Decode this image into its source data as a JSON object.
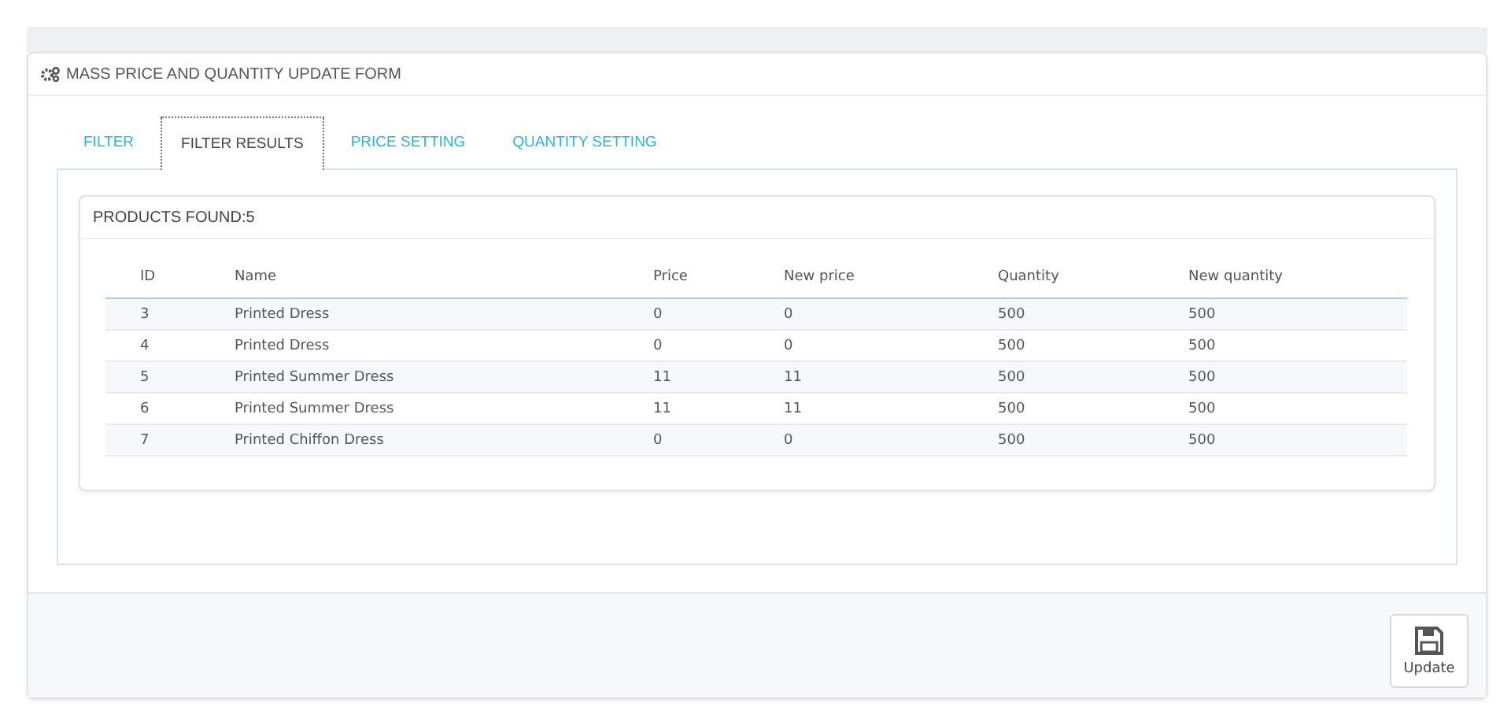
{
  "panel": {
    "title": "MASS PRICE AND QUANTITY UPDATE FORM"
  },
  "tabs": [
    {
      "label": "FILTER",
      "selected": false
    },
    {
      "label": "FILTER RESULTS",
      "selected": true
    },
    {
      "label": "PRICE SETTING",
      "selected": false
    },
    {
      "label": "QUANTITY SETTING",
      "selected": false
    }
  ],
  "results": {
    "title": "PRODUCTS FOUND:5",
    "columns": [
      "ID",
      "Name",
      "Price",
      "New price",
      "Quantity",
      "New quantity"
    ],
    "rows": [
      [
        "3",
        "Printed Dress",
        "0",
        "0",
        "500",
        "500"
      ],
      [
        "4",
        "Printed Dress",
        "0",
        "0",
        "500",
        "500"
      ],
      [
        "5",
        "Printed Summer Dress",
        "11",
        "11",
        "500",
        "500"
      ],
      [
        "6",
        "Printed Summer Dress",
        "11",
        "11",
        "500",
        "500"
      ],
      [
        "7",
        "Printed Chiffon Dress",
        "0",
        "0",
        "500",
        "500"
      ]
    ]
  },
  "footer": {
    "button": "Update"
  }
}
